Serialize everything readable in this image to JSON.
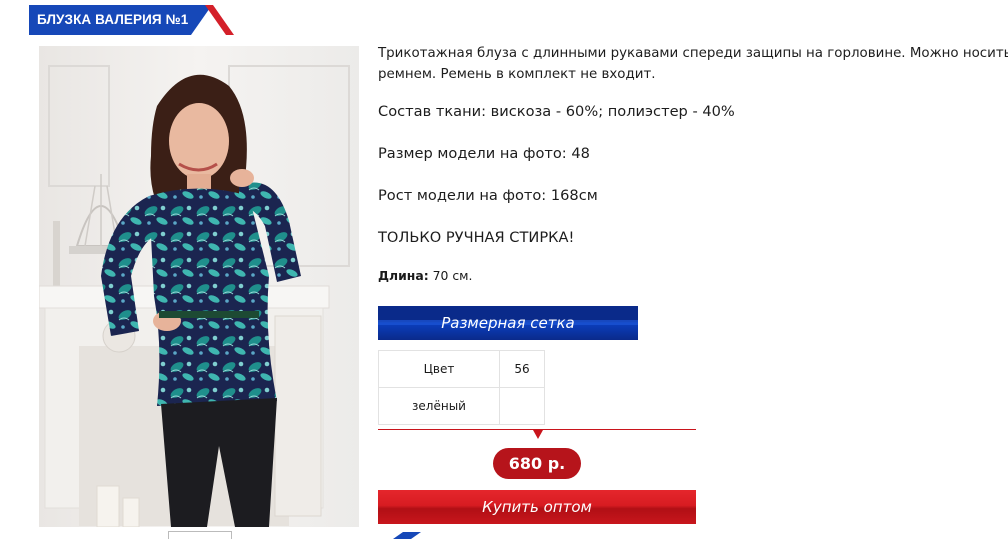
{
  "product": {
    "title": "БЛУЗКА ВАЛЕРИЯ №1",
    "description_line1": "Трикотажная блуза с длинными рукавами спереди защипы на горловине. Можно носить с",
    "description_line2": "ремнем. Ремень в комплект не входит.",
    "fabric": "Состав ткани: вискоза - 60%; полиэстер - 40%",
    "model_size": "Размер модели на фото: 48",
    "model_height": "Рост модели на фото: 168см",
    "care": "ТОЛЬКО РУЧНАЯ СТИРКА!",
    "length_label": "Длина:",
    "length_value": "70 см.",
    "size_chart_label": "Размерная сетка",
    "table": {
      "header": [
        "Цвет",
        "56"
      ],
      "rows": [
        [
          "зелёный",
          ""
        ]
      ]
    },
    "price": "680 р.",
    "buy_label": "Купить оптом"
  },
  "colors": {
    "brand_blue": "#1648b8",
    "accent_red": "#c9141c",
    "price_red": "#b6141b"
  }
}
